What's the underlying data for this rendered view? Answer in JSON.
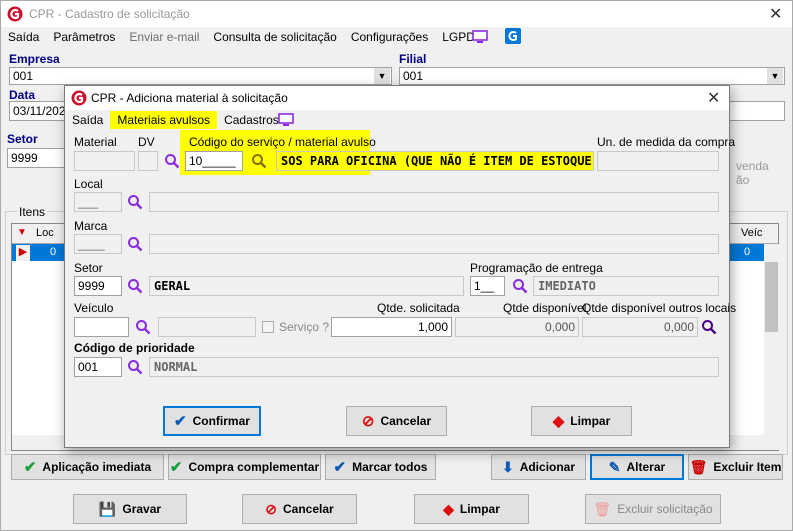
{
  "main_window": {
    "title": "CPR - Cadastro de solicitação",
    "menu": [
      "Saída",
      "Parâmetros",
      "Enviar e-mail",
      "Consulta de solicitação",
      "Configurações",
      "LGPD"
    ],
    "labels": {
      "empresa": "Empresa",
      "filial": "Filial",
      "data": "Data",
      "setor": "Setor",
      "itens": "Itens"
    },
    "empresa_value": "001",
    "filial_value": "001",
    "data_value": "03/11/2020",
    "setor_value": "9999",
    "side_text": "venda\não",
    "grid_headers": [
      "Loc",
      "Veíc"
    ],
    "grid_row": {
      "loc": "0",
      "veic": "0"
    },
    "buttons": {
      "aplicacao": "Aplicação imediata",
      "compra": "Compra complementar",
      "marcar": "Marcar todos",
      "adicionar": "Adicionar",
      "alterar": "Alterar",
      "excluir_item": "Excluir Item",
      "gravar": "Gravar",
      "cancelar": "Cancelar",
      "limpar": "Limpar",
      "excluir_solicitacao": "Excluir solicitação"
    }
  },
  "dialog": {
    "title": "CPR - Adiciona material à solicitação",
    "menu": [
      "Saída",
      "Materiais avulsos",
      "Cadastros"
    ],
    "labels": {
      "material": "Material",
      "dv": "DV",
      "codigo": "Código do serviço / material avulso",
      "un_medida": "Un. de medida da compra",
      "local": "Local",
      "marca": "Marca",
      "setor": "Setor",
      "programacao": "Programação de entrega",
      "veiculo": "Veículo",
      "servico": "Serviço ?",
      "qtde_solicitada": "Qtde. solicitada",
      "qtde_disponivel": "Qtde disponível",
      "qtde_outros": "Qtde disponível outros locais",
      "codigo_prioridade": "Código de prioridade"
    },
    "values": {
      "local": "___",
      "marca": "____",
      "codigo": "10_____",
      "codigo_desc": "SOS PARA OFICINA (QUE NÃO É ITEM DE ESTOQUE)",
      "setor": "9999",
      "setor_desc": "GERAL",
      "programacao": "1__",
      "programacao_desc": "IMEDIATO",
      "qtde_solicitada": "1,000",
      "qtde_disponivel": "0,000",
      "qtde_outros": "0,000",
      "prioridade": "001",
      "prioridade_desc": "NORMAL"
    },
    "buttons": {
      "confirmar": "Confirmar",
      "cancelar": "Cancelar",
      "limpar": "Limpar"
    }
  },
  "colors": {
    "highlight": "#ffff00",
    "accent": "#0078d7",
    "brand": "#c8102e",
    "magnifier": "#8a2be2"
  }
}
